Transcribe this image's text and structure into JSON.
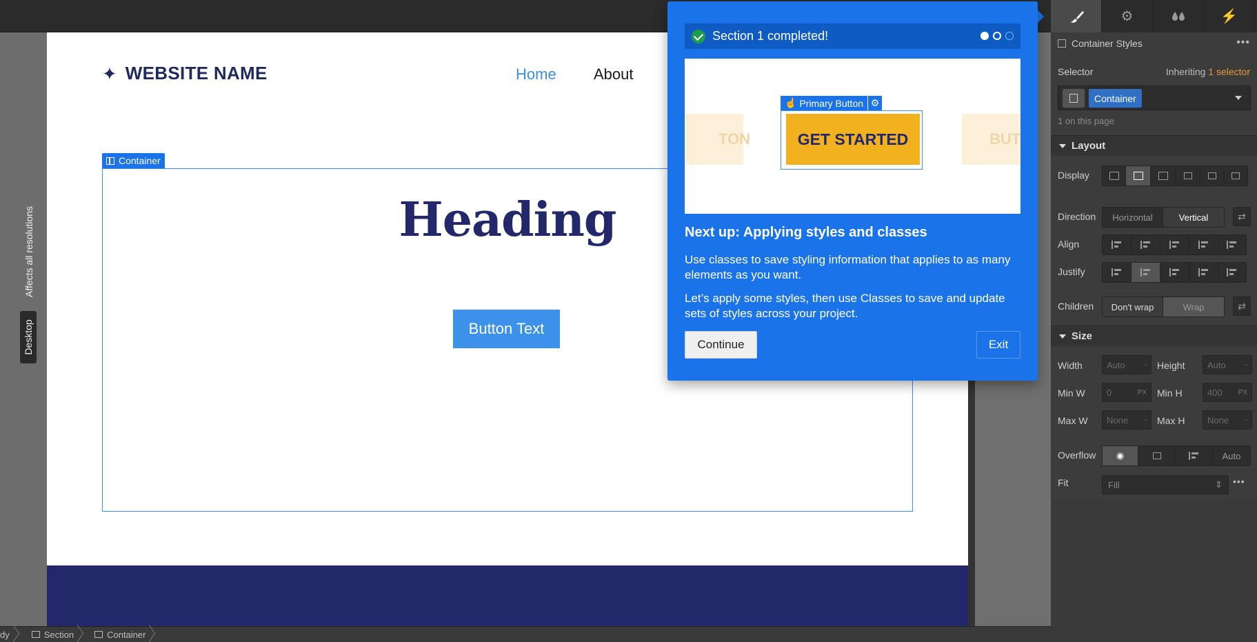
{
  "canvas": {
    "brand_star": "✦",
    "brand_name": "WEBSITE NAME",
    "nav": [
      "Home",
      "About"
    ],
    "container_tag": "Container",
    "heading": "Heading",
    "button_text": "Button Text",
    "colors": {
      "heading": "#23286a",
      "button": "#3c92e8",
      "nav_active": "#3c8fe0",
      "footer": "#23286a",
      "selection": "#1a73e8"
    }
  },
  "gutter": {
    "affects_label": "Affects all resolutions",
    "breakpoint_label": "Desktop"
  },
  "breadcrumb": [
    "dy",
    "Section",
    "Container"
  ],
  "tutorial": {
    "status_text": "Section 1 completed!",
    "progress": {
      "completed": 1,
      "current": 2,
      "total": 3
    },
    "preview": {
      "ghost_left": "TON",
      "ghost_right": "BUT",
      "element_tag": "Primary Button",
      "button_label": "GET STARTED"
    },
    "title": "Next up: Applying styles and classes",
    "paragraph_1": "Use classes to save styling information that applies to as many elements as you want.",
    "paragraph_2": "Let’s apply some styles, then use Classes to save and update sets of styles across your project.",
    "continue_label": "Continue",
    "exit_label": "Exit"
  },
  "panel": {
    "tabs": [
      {
        "icon": "brush-icon",
        "active": true
      },
      {
        "icon": "gear-icon",
        "active": false
      },
      {
        "icon": "drops-icon",
        "active": false
      },
      {
        "icon": "lightning-icon",
        "active": false
      }
    ],
    "title": "Container Styles",
    "selector_label": "Selector",
    "inheriting_prefix": "Inheriting",
    "inheriting_count": "1 selector",
    "selector_chip": "Container",
    "on_page": "1 on this page",
    "layout": {
      "section_label": "Layout",
      "display_label": "Display",
      "direction_label": "Direction",
      "direction_options": [
        "Horizontal",
        "Vertical"
      ],
      "direction_selected": "Vertical",
      "align_label": "Align",
      "justify_label": "Justify",
      "children_label": "Children",
      "children_options": [
        "Don't wrap",
        "Wrap"
      ],
      "children_selected": "Don't wrap"
    },
    "size": {
      "section_label": "Size",
      "width_label": "Width",
      "width_value": "Auto",
      "height_label": "Height",
      "height_value": "Auto",
      "minw_label": "Min W",
      "minw_value": "0",
      "minw_unit": "PX",
      "minh_label": "Min H",
      "minh_value": "400",
      "minh_unit": "PX",
      "maxw_label": "Max W",
      "maxw_value": "None",
      "maxh_label": "Max H",
      "maxh_value": "None",
      "dash": "-",
      "overflow_label": "Overflow",
      "overflow_auto": "Auto",
      "fit_label": "Fit",
      "fit_value": "Fill"
    }
  }
}
